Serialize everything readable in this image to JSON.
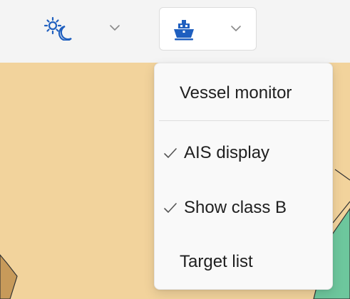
{
  "toolbar": {
    "theme_icon": "sun-moon-icon",
    "vessel_icon": "ship-icon",
    "chevron_icon": "chevron-down-icon",
    "accent_color": "#1f5fbf"
  },
  "menu": {
    "header": "Vessel monitor",
    "items": [
      {
        "label": "AIS display",
        "checked": true
      },
      {
        "label": "Show class B",
        "checked": true
      },
      {
        "label": "Target list",
        "checked": false
      }
    ],
    "check_icon": "checkmark-icon"
  },
  "map": {
    "land_color": "#f2d39c",
    "water_color": "#6dc79d",
    "tan_color": "#c79a5a"
  }
}
